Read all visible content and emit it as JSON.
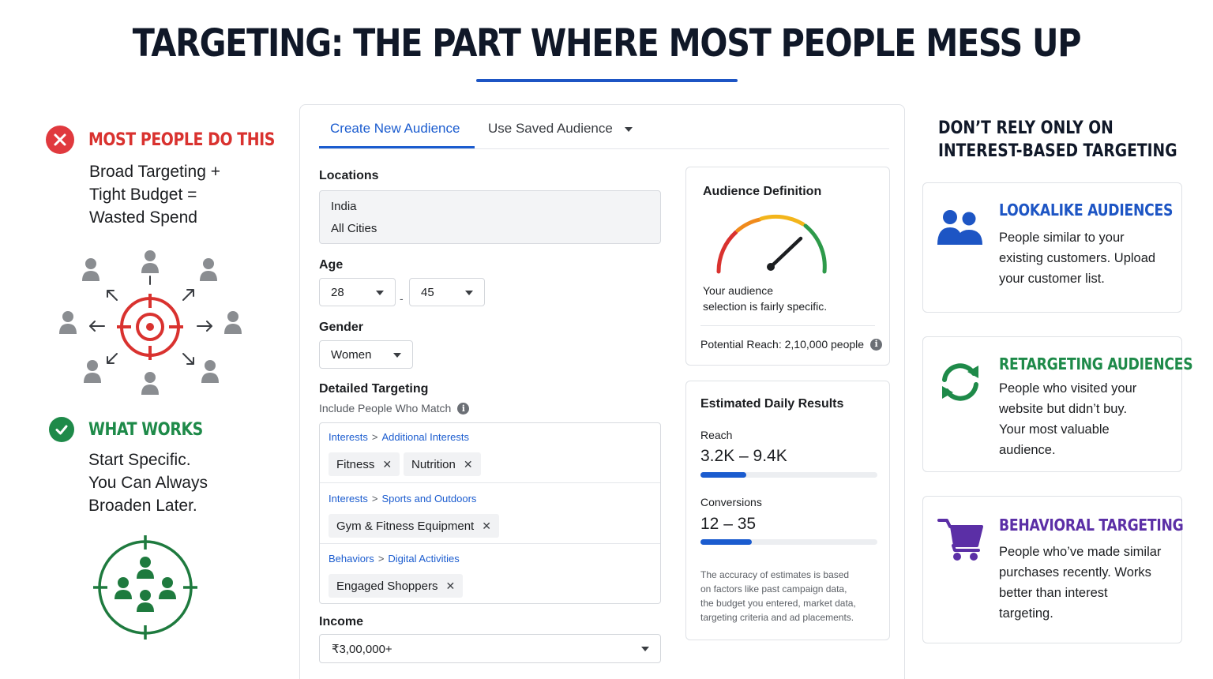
{
  "title": "TARGETING: THE PART WHERE MOST PEOPLE MESS UP",
  "left": {
    "bad": {
      "label": "MOST PEOPLE DO THIS",
      "lines": [
        "Broad Targeting +",
        "Tight Budget =",
        "Wasted Spend"
      ]
    },
    "good": {
      "label": "WHAT WORKS",
      "lines": [
        "Start Specific.",
        "You Can Always",
        "Broaden Later."
      ]
    }
  },
  "panel": {
    "tabs": {
      "active": "Create New Audience",
      "other": "Use Saved Audience"
    },
    "locations": {
      "label": "Locations",
      "country": "India",
      "cities": "All Cities"
    },
    "age": {
      "label": "Age",
      "min": "28",
      "separator": "-",
      "max": "45"
    },
    "gender": {
      "label": "Gender",
      "value": "Women"
    },
    "detailed": {
      "label": "Detailed Targeting",
      "sub": "Include People Who Match",
      "sections": [
        {
          "category": "Interests",
          "subcategory": "Additional Interests",
          "chips": [
            "Fitness",
            "Nutrition"
          ]
        },
        {
          "category": "Interests",
          "subcategory": "Sports and Outdoors",
          "chips": [
            "Gym & Fitness Equipment"
          ]
        },
        {
          "category": "Behaviors",
          "subcategory": "Digital Activities",
          "chips": [
            "Engaged Shoppers"
          ]
        }
      ],
      "separator": ">",
      "remove_glyph": "✕"
    },
    "income": {
      "label": "Income",
      "value": "₹3,00,000+"
    },
    "definition": {
      "title": "Audience Definition",
      "desc_line1": "Your audience",
      "desc_line2": "selection is fairly specific.",
      "reach": "Potential Reach: 2,10,000 people"
    },
    "estimates": {
      "title": "Estimated Daily Results",
      "reach_label": "Reach",
      "reach_value": "3.2K – 9.4K",
      "reach_fill": 0.26,
      "conv_label": "Conversions",
      "conv_value": "12 – 35",
      "conv_fill": 0.29,
      "disclaimer": [
        "The accuracy of estimates is based",
        "on factors like past campaign data,",
        "the budget you entered, market data,",
        "targeting criteria and ad placements."
      ]
    }
  },
  "right": {
    "head_line1": "DON’T RELY ONLY ON",
    "head_line2": "INTEREST-BASED TARGETING",
    "cards": [
      {
        "title": "LOOKALIKE AUDIENCES",
        "color": "#1d55c4",
        "icon": "people-icon",
        "lines": [
          "People similar to your",
          "existing customers. Upload",
          "your customer list."
        ]
      },
      {
        "title": "RETARGETING AUDIENCES",
        "color": "#1e8a49",
        "icon": "refresh-icon",
        "lines": [
          "People who visited your",
          "website but didn’t buy.",
          "Your most valuable",
          "audience."
        ]
      },
      {
        "title": "BEHAVIORAL TARGETING",
        "color": "#5b2fa6",
        "icon": "cart-icon",
        "lines": [
          "People who’ve made similar",
          "purchases recently. Works",
          "better than interest",
          "targeting."
        ]
      }
    ]
  },
  "colors": {
    "accent": "#1b5ccf",
    "bad": "#e0393e",
    "good": "#1e8a49",
    "purple": "#5b2fa6"
  }
}
